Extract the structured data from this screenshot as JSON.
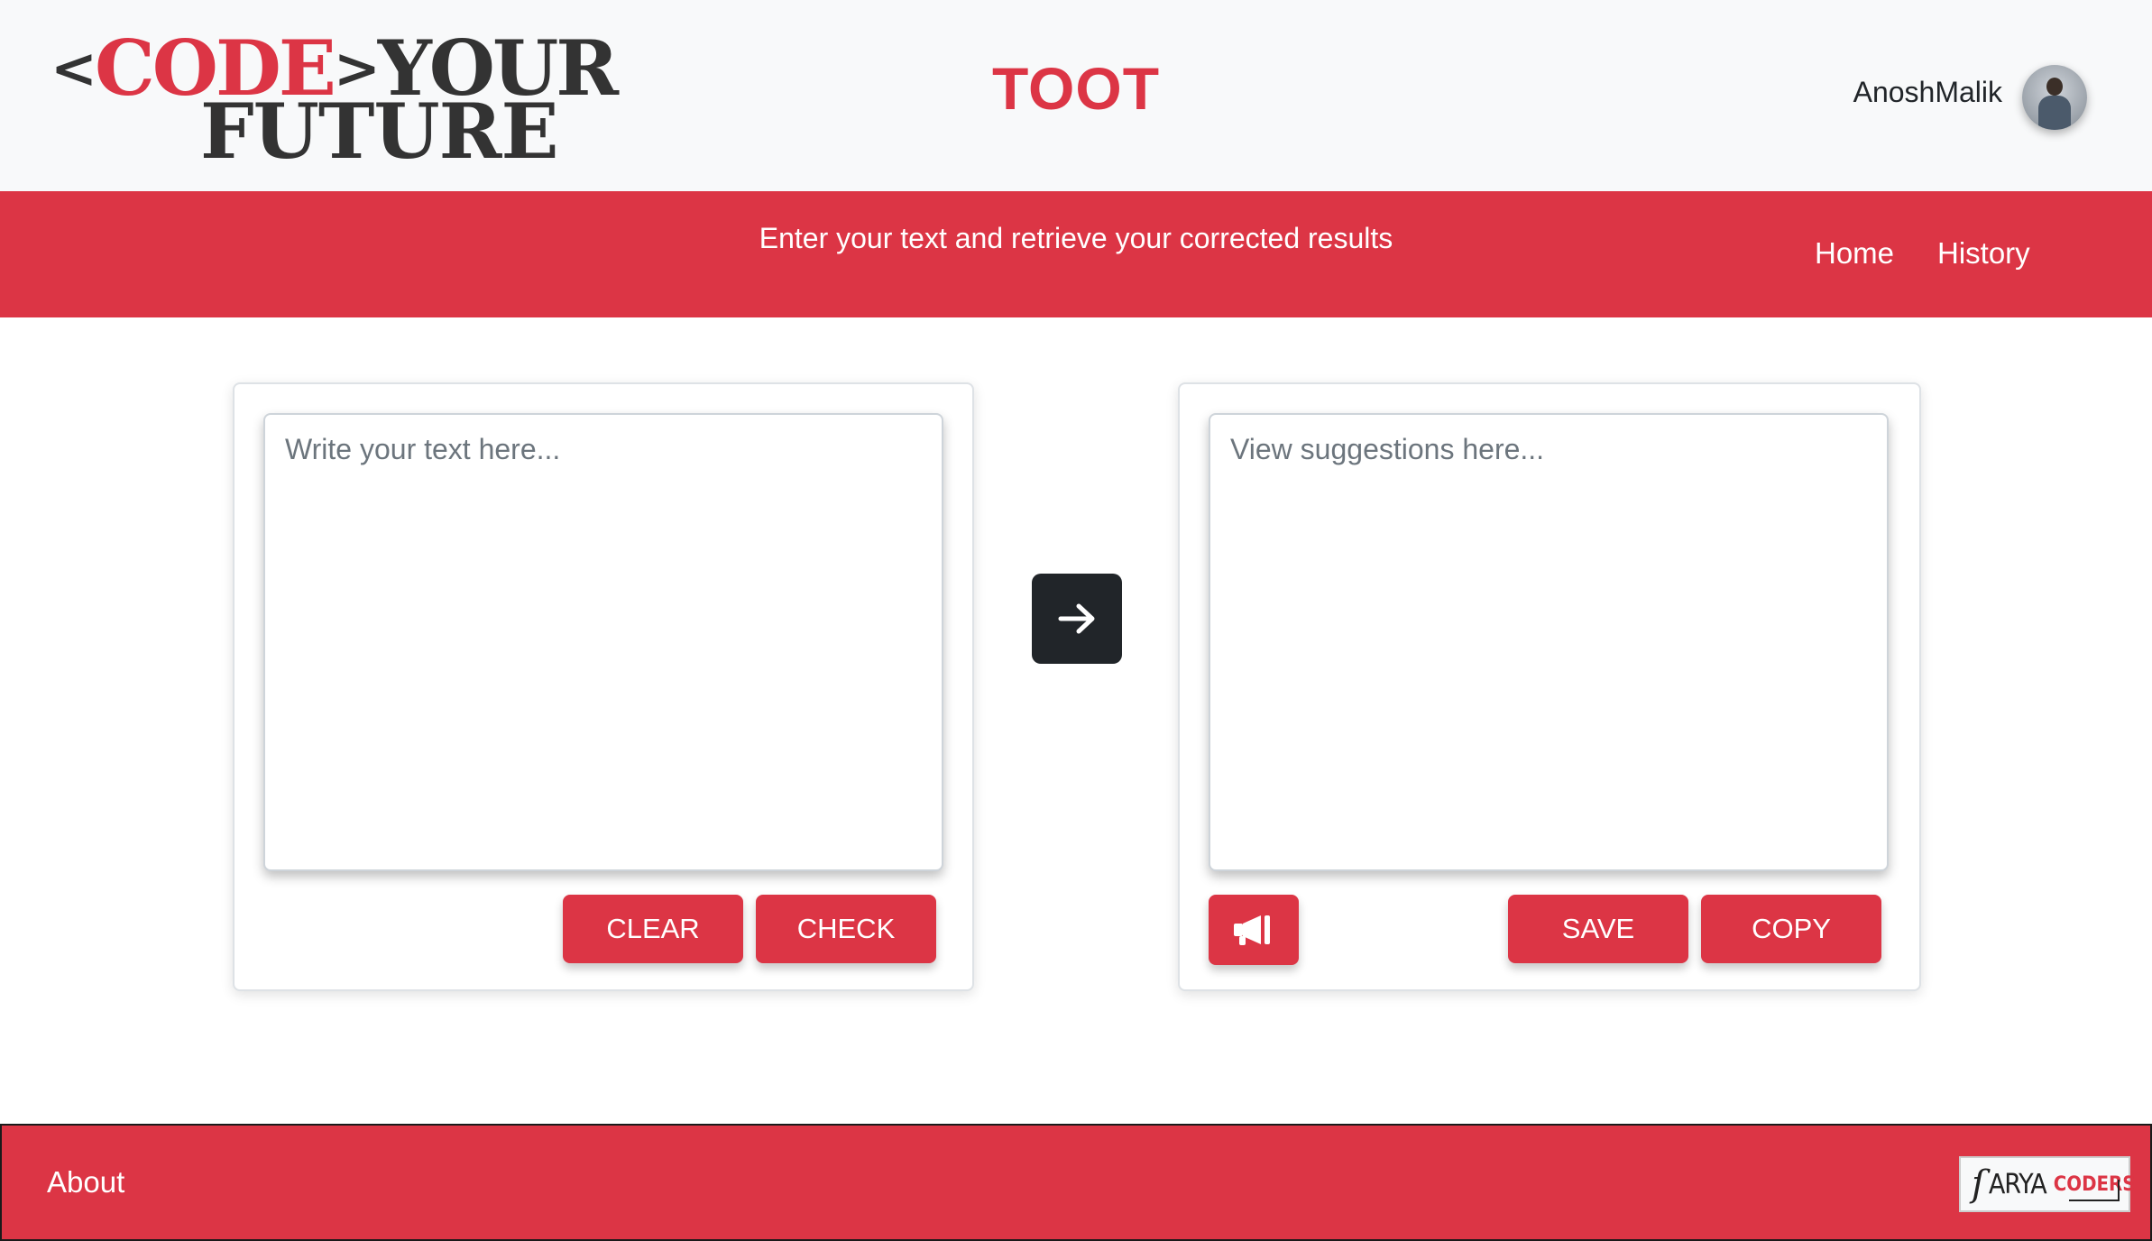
{
  "header": {
    "logo": {
      "bracket_open": "<",
      "code": "CODE",
      "bracket_close": ">",
      "your": "YOUR",
      "future": "FUTURE"
    },
    "app_title": "TOOT",
    "user": {
      "name": "AnoshMalik"
    }
  },
  "navbar": {
    "tagline": "Enter your text and retrieve your corrected results",
    "links": [
      {
        "label": "Home"
      },
      {
        "label": "History"
      }
    ]
  },
  "input_card": {
    "placeholder": "Write your text here...",
    "value": "",
    "clear_label": "CLEAR",
    "check_label": "CHECK"
  },
  "output_card": {
    "placeholder": "View suggestions here...",
    "value": "",
    "save_label": "SAVE",
    "copy_label": "COPY"
  },
  "footer": {
    "about_label": "About",
    "brand": {
      "arya": "ARYA",
      "coders": "CODERS"
    }
  },
  "colors": {
    "accent": "#dc3545",
    "dark": "#212529",
    "header_bg": "#f8f9fa"
  },
  "icons": {
    "arrow_button": "arrow-right-icon",
    "speak_button": "megaphone-icon"
  }
}
